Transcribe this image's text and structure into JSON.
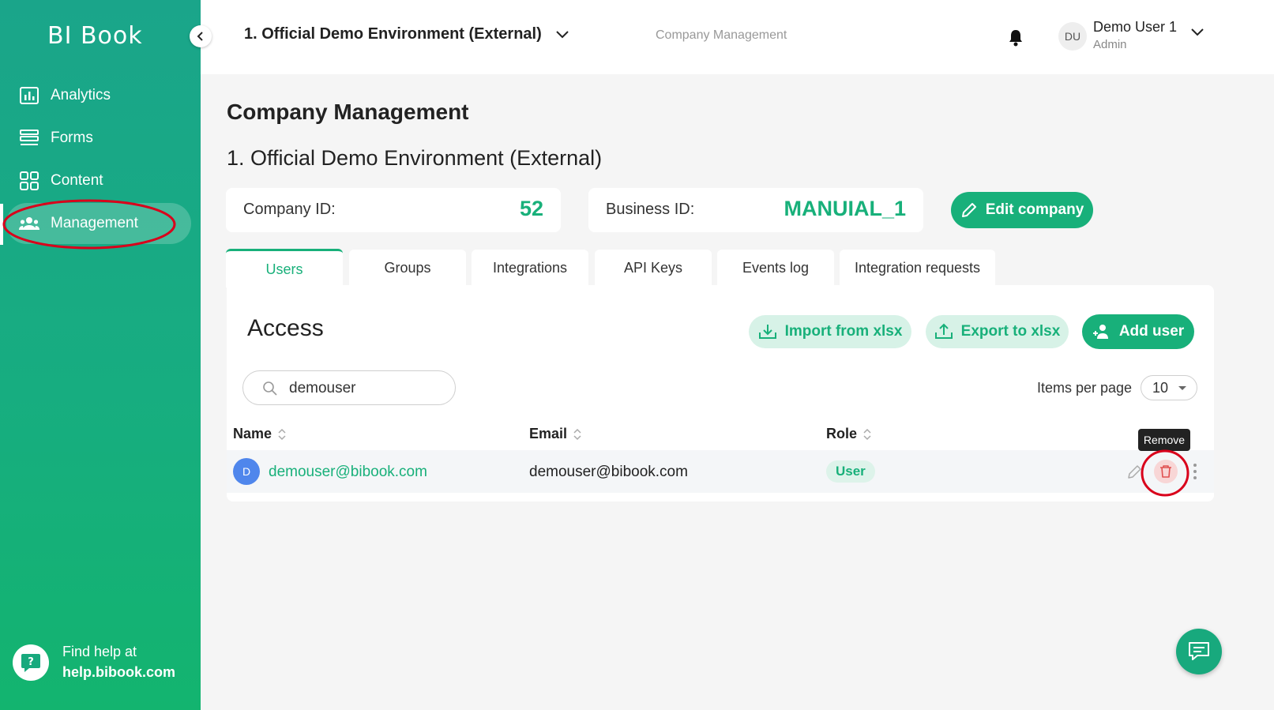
{
  "sidebar": {
    "logo": "BI Book",
    "items": [
      {
        "label": "Analytics",
        "icon": "analytics-icon"
      },
      {
        "label": "Forms",
        "icon": "forms-icon"
      },
      {
        "label": "Content",
        "icon": "content-icon"
      },
      {
        "label": "Management",
        "icon": "management-icon",
        "active": true
      }
    ],
    "help": {
      "line1": "Find help at",
      "line2": "help.bibook.com"
    }
  },
  "header": {
    "environment": "1. Official Demo Environment (External)",
    "breadcrumb": "Company Management",
    "user": {
      "initials": "DU",
      "name": "Demo User 1",
      "role": "Admin"
    }
  },
  "main": {
    "title": "Company Management",
    "subtitle": "1. Official Demo Environment (External)",
    "company_id_label": "Company ID:",
    "company_id_value": "52",
    "business_id_label": "Business ID:",
    "business_id_value": "MANUIAL_1",
    "edit_button": "Edit company",
    "tabs": [
      {
        "label": "Users",
        "active": true
      },
      {
        "label": "Groups"
      },
      {
        "label": "Integrations"
      },
      {
        "label": "API Keys"
      },
      {
        "label": "Events log"
      },
      {
        "label": "Integration requests"
      }
    ]
  },
  "access": {
    "title": "Access",
    "import_button": "Import from xlsx",
    "export_button": "Export to xlsx",
    "add_button": "Add user",
    "search_value": "demouser",
    "items_per_page_label": "Items per page",
    "items_per_page_value": "10",
    "columns": {
      "name": "Name",
      "email": "Email",
      "role": "Role"
    },
    "rows": [
      {
        "initial": "D",
        "name": "demouser@bibook.com",
        "email": "demouser@bibook.com",
        "role": "User"
      }
    ],
    "tooltip": "Remove"
  },
  "colors": {
    "accent": "#18b07a",
    "sidebar_top": "#1aa58a",
    "sidebar_bottom": "#13b46f",
    "annotation": "#d9001b"
  }
}
